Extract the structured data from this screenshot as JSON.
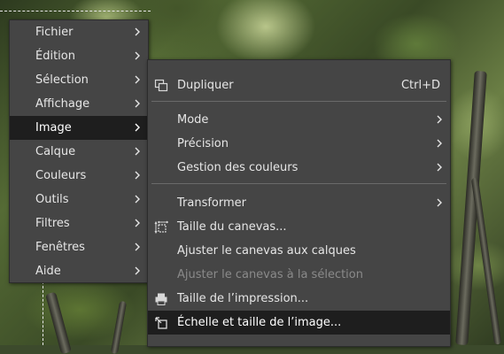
{
  "main_menu": {
    "items": [
      {
        "label": "Fichier"
      },
      {
        "label": "Édition"
      },
      {
        "label": "Sélection"
      },
      {
        "label": "Affichage"
      },
      {
        "label": "Image"
      },
      {
        "label": "Calque"
      },
      {
        "label": "Couleurs"
      },
      {
        "label": "Outils"
      },
      {
        "label": "Filtres"
      },
      {
        "label": "Fenêtres"
      },
      {
        "label": "Aide"
      }
    ],
    "active_item": "Image"
  },
  "image_submenu": {
    "duplicate": {
      "label": "Dupliquer",
      "shortcut": "Ctrl+D",
      "icon": "duplicate-icon"
    },
    "mode": {
      "label": "Mode"
    },
    "precision": {
      "label": "Précision"
    },
    "color_management": {
      "label": "Gestion des couleurs"
    },
    "transform": {
      "label": "Transformer"
    },
    "canvas_size": {
      "label": "Taille du canevas...",
      "icon": "canvas-size-icon"
    },
    "fit_canvas_layers": {
      "label": "Ajuster le canevas aux calques"
    },
    "fit_canvas_selection": {
      "label": "Ajuster le canevas à la sélection",
      "disabled": true
    },
    "print_size": {
      "label": "Taille de l’impression...",
      "icon": "printer-icon"
    },
    "scale_image": {
      "label": "Échelle et taille de l’image...",
      "icon": "scale-image-icon",
      "highlighted": true
    }
  },
  "colors": {
    "menu_bg": "#454545",
    "highlight_bg": "#1e1e1e",
    "text": "#e6e6e6",
    "disabled_text": "#8a8a8a",
    "separator": "#6a6a6a"
  }
}
